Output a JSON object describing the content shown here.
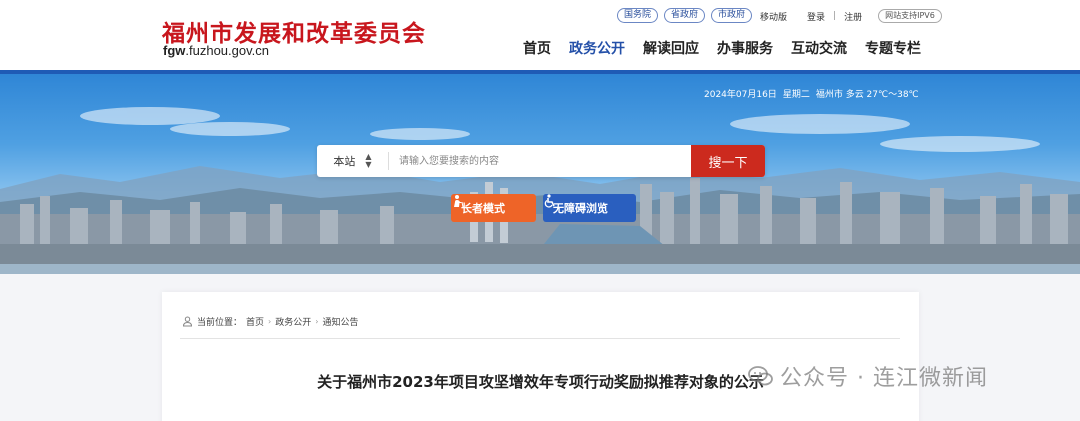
{
  "header": {
    "site_title": "福州市发展和改革委员会",
    "domain_prefix": "fgw",
    "domain_suffix": ".fuzhou.gov.cn",
    "gov_links": [
      "国务院",
      "省政府",
      "市政府"
    ],
    "mobile_label": "移动版",
    "login_label": "登录",
    "register_label": "注册",
    "ipv6_label": "网站支持IPV6",
    "nav": [
      {
        "label": "首页",
        "active": false
      },
      {
        "label": "政务公开",
        "active": true
      },
      {
        "label": "解读回应",
        "active": false
      },
      {
        "label": "办事服务",
        "active": false
      },
      {
        "label": "互动交流",
        "active": false
      },
      {
        "label": "专题专栏",
        "active": false
      }
    ]
  },
  "banner": {
    "date": "2024年07月16日",
    "weekday": "星期二",
    "weather": "福州市 多云 27℃～38℃",
    "search": {
      "scope": "本站",
      "placeholder": "请输入您要搜索的内容",
      "button": "搜一下"
    },
    "elder_mode": "长者模式",
    "accessible_mode": "无障碍浏览"
  },
  "content": {
    "breadcrumb": {
      "prefix": "当前位置：",
      "items": [
        "首页",
        "政务公开",
        "通知公告"
      ]
    },
    "article_title": "关于福州市2023年项目攻坚增效年专项行动奖励拟推荐对象的公示"
  },
  "watermark": {
    "text": "公众号 · 连江微新闻"
  },
  "colors": {
    "brand_red": "#c8161d",
    "nav_active": "#2450a8",
    "search_button": "#cc2a1e",
    "elder_button": "#ee6428",
    "accessible_button": "#2a5fbf"
  }
}
